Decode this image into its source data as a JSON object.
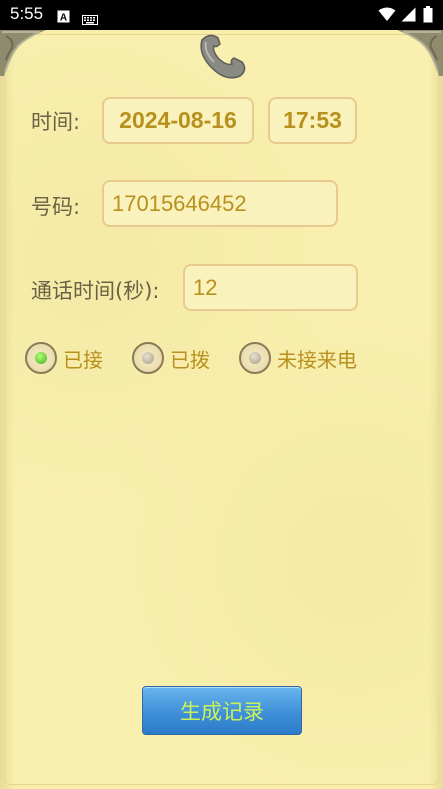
{
  "status_bar": {
    "time": "5:55",
    "icons": [
      "a-notification-icon",
      "keyboard-icon",
      "wifi-icon",
      "signal-icon",
      "battery-icon"
    ]
  },
  "form": {
    "time_label": "时间:",
    "date_value": "2024-08-16",
    "time_value": "17:53",
    "number_label": "号码:",
    "number_value": "17015646452",
    "duration_label": "通话时间(秒):",
    "duration_value": "12"
  },
  "call_type": {
    "options": [
      {
        "label": "已接",
        "selected": true
      },
      {
        "label": "已拨",
        "selected": false
      },
      {
        "label": "未接来电",
        "selected": false
      }
    ]
  },
  "actions": {
    "generate_label": "生成记录"
  },
  "colors": {
    "paper": "#f8eda9",
    "value_text": "#b8901e",
    "label_text": "#6b6245",
    "button_blue": "#3f90d8",
    "button_text": "#c9f25a"
  }
}
